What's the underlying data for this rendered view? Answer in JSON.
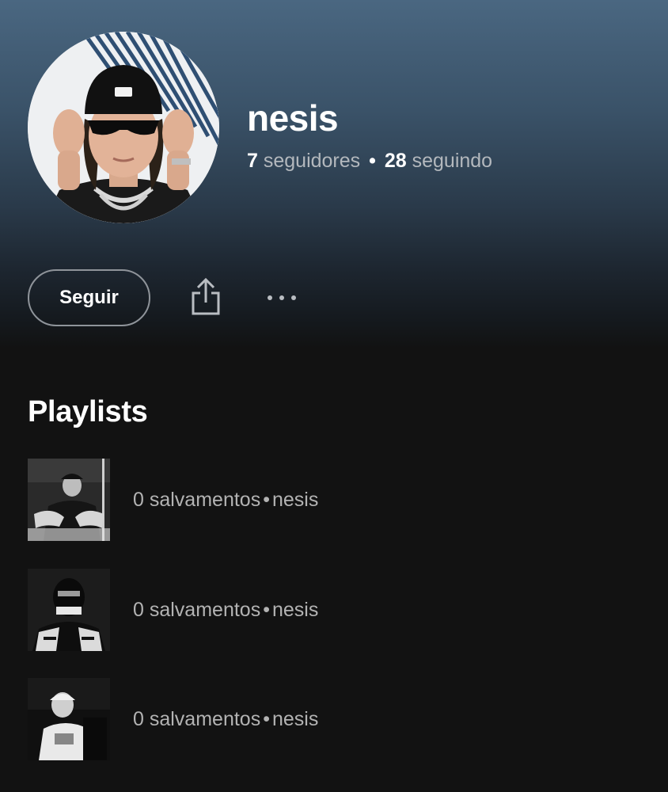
{
  "profile": {
    "name": "nesis",
    "followers_count": "7",
    "followers_label": "seguidores",
    "following_count": "28",
    "following_label": "seguindo",
    "separator": "•"
  },
  "actions": {
    "follow_label": "Seguir",
    "share_icon": "share-icon",
    "more_icon": "more-options-icon"
  },
  "playlists_section": {
    "title": "Playlists",
    "items": [
      {
        "saves": "0 salvamentos",
        "separator": "•",
        "owner": "nesis"
      },
      {
        "saves": "0 salvamentos",
        "separator": "•",
        "owner": "nesis"
      },
      {
        "saves": "0 salvamentos",
        "separator": "•",
        "owner": "nesis"
      }
    ]
  },
  "colors": {
    "header_gradient_top": "#4a6781",
    "background": "#121212",
    "muted_text": "#b3b3b3",
    "button_border": "#8f949a"
  }
}
